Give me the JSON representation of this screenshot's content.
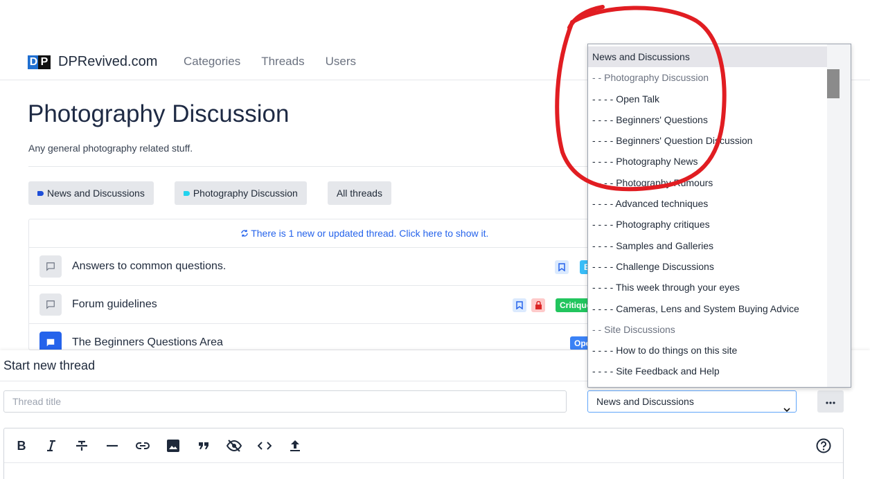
{
  "header": {
    "logo_text": "DPRevived.com",
    "logo_letters": [
      "D",
      "P"
    ],
    "nav": [
      "Categories",
      "Threads",
      "Users"
    ]
  },
  "category": {
    "title": "Photography Discussion",
    "description": "Any general photography related stuff."
  },
  "pills": [
    {
      "label": "News and Discussions",
      "color": "#1d4ed8"
    },
    {
      "label": "Photography Discussion",
      "color": "#22d3ee"
    },
    {
      "label": "All threads"
    }
  ],
  "threads": {
    "notice": "There is 1 new or updated thread. Click here to show it.",
    "rows": [
      {
        "title": "Answers to common questions.",
        "badge": "B",
        "badge_color": "#38bdf8"
      },
      {
        "title": "Forum guidelines",
        "badge": "Critique",
        "badge_color": "#22c55e"
      },
      {
        "title": "The Beginners Questions Area",
        "badge": "Ope",
        "badge_color": "#3b82f6"
      }
    ]
  },
  "composer": {
    "title": "Start new thread",
    "title_placeholder": "Thread title",
    "category_value": "News and Discussions"
  },
  "dropdown": {
    "options": [
      {
        "label": "News and Discussions",
        "type": "selected"
      },
      {
        "label": "- - Photography Discussion",
        "type": "group"
      },
      {
        "label": "- - - - Open Talk",
        "type": "item"
      },
      {
        "label": "- - - - Beginners' Questions",
        "type": "item"
      },
      {
        "label": "- - - - Beginners' Question Discussion",
        "type": "item"
      },
      {
        "label": "- - - - Photography News",
        "type": "item"
      },
      {
        "label": "- - - - Photography Rumours",
        "type": "item"
      },
      {
        "label": "- - - - Advanced techniques",
        "type": "item"
      },
      {
        "label": "- - - - Photography critiques",
        "type": "item"
      },
      {
        "label": "- - - - Samples and Galleries",
        "type": "item"
      },
      {
        "label": "- - - - Challenge Discussions",
        "type": "item"
      },
      {
        "label": "- - - - This week through your eyes",
        "type": "item"
      },
      {
        "label": "- - - - Cameras, Lens and System Buying Advice",
        "type": "item"
      },
      {
        "label": "- - Site Discussions",
        "type": "group"
      },
      {
        "label": "- - - - How to do things on this site",
        "type": "item"
      },
      {
        "label": "- - - - Site Feedback and Help",
        "type": "item"
      }
    ]
  },
  "toolbar_icons": [
    "bold-icon",
    "italic-icon",
    "strikethrough-icon",
    "horizontal-rule-icon",
    "link-icon",
    "image-icon",
    "quote-icon",
    "spoiler-icon",
    "code-icon",
    "upload-icon",
    "help-icon"
  ],
  "colors": {
    "accent": "#2563eb",
    "annotation": "#e11d22"
  }
}
